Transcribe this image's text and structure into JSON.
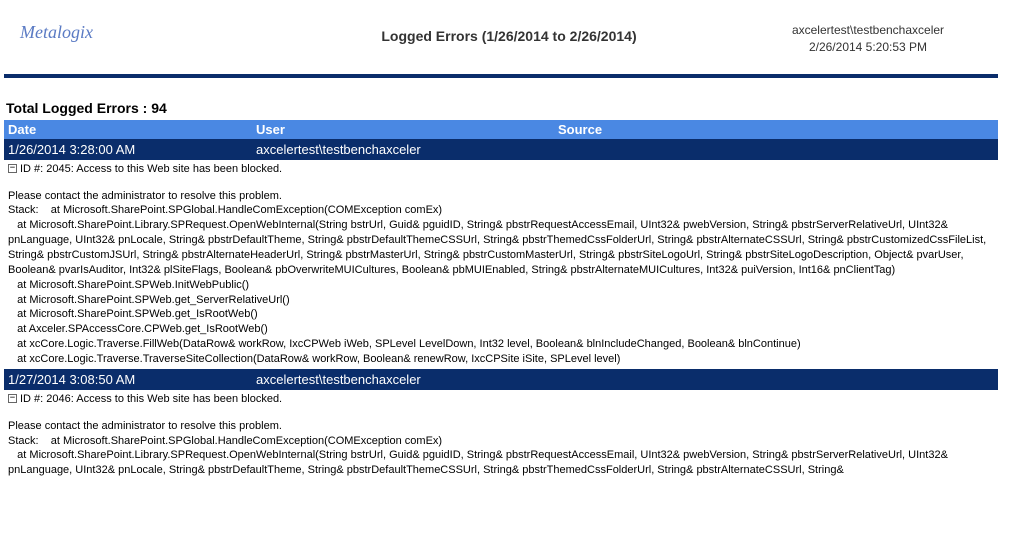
{
  "brand": "Metalogix",
  "report_title": "Logged Errors  (1/26/2014 to 2/26/2014)",
  "header_user": "axcelertest\\testbenchaxceler",
  "header_timestamp": "2/26/2014 5:20:53 PM",
  "total_label": "Total Logged Errors : 94",
  "columns": {
    "date": "Date",
    "user": "User",
    "source": "Source"
  },
  "collapse_glyph": "−",
  "entries": [
    {
      "date": "1/26/2014 3:28:00 AM",
      "user": "axcelertest\\testbenchaxceler",
      "source": "",
      "id_line": "ID #: 2045: Access to this Web site has been blocked.",
      "message": "Please contact the administrator to resolve this problem.",
      "stack": "Stack:    at Microsoft.SharePoint.SPGlobal.HandleComException(COMException comEx)\n   at Microsoft.SharePoint.Library.SPRequest.OpenWebInternal(String bstrUrl, Guid& pguidID, String& pbstrRequestAccessEmail, UInt32& pwebVersion, String& pbstrServerRelativeUrl, UInt32& pnLanguage, UInt32& pnLocale, String& pbstrDefaultTheme, String& pbstrDefaultThemeCSSUrl, String& pbstrThemedCssFolderUrl, String& pbstrAlternateCSSUrl, String& pbstrCustomizedCssFileList, String& pbstrCustomJSUrl, String& pbstrAlternateHeaderUrl, String& pbstrMasterUrl, String& pbstrCustomMasterUrl, String& pbstrSiteLogoUrl, String& pbstrSiteLogoDescription, Object& pvarUser, Boolean& pvarIsAuditor, Int32& plSiteFlags, Boolean& pbOverwriteMUICultures, Boolean& pbMUIEnabled, String& pbstrAlternateMUICultures, Int32& puiVersion, Int16& pnClientTag)\n   at Microsoft.SharePoint.SPWeb.InitWebPublic()\n   at Microsoft.SharePoint.SPWeb.get_ServerRelativeUrl()\n   at Microsoft.SharePoint.SPWeb.get_IsRootWeb()\n   at Axceler.SPAccessCore.CPWeb.get_IsRootWeb()\n   at xcCore.Logic.Traverse.FillWeb(DataRow& workRow, IxcCPWeb iWeb, SPLevel LevelDown, Int32 level, Boolean& blnIncludeChanged, Boolean& blnContinue)\n   at xcCore.Logic.Traverse.TraverseSiteCollection(DataRow& workRow, Boolean& renewRow, IxcCPSite iSite, SPLevel level)"
    },
    {
      "date": "1/27/2014 3:08:50 AM",
      "user": "axcelertest\\testbenchaxceler",
      "source": "",
      "id_line": "ID #: 2046: Access to this Web site has been blocked.",
      "message": "Please contact the administrator to resolve this problem.",
      "stack": "Stack:    at Microsoft.SharePoint.SPGlobal.HandleComException(COMException comEx)\n   at Microsoft.SharePoint.Library.SPRequest.OpenWebInternal(String bstrUrl, Guid& pguidID, String& pbstrRequestAccessEmail, UInt32& pwebVersion, String& pbstrServerRelativeUrl, UInt32& pnLanguage, UInt32& pnLocale, String& pbstrDefaultTheme, String& pbstrDefaultThemeCSSUrl, String& pbstrThemedCssFolderUrl, String& pbstrAlternateCSSUrl, String&"
    }
  ]
}
